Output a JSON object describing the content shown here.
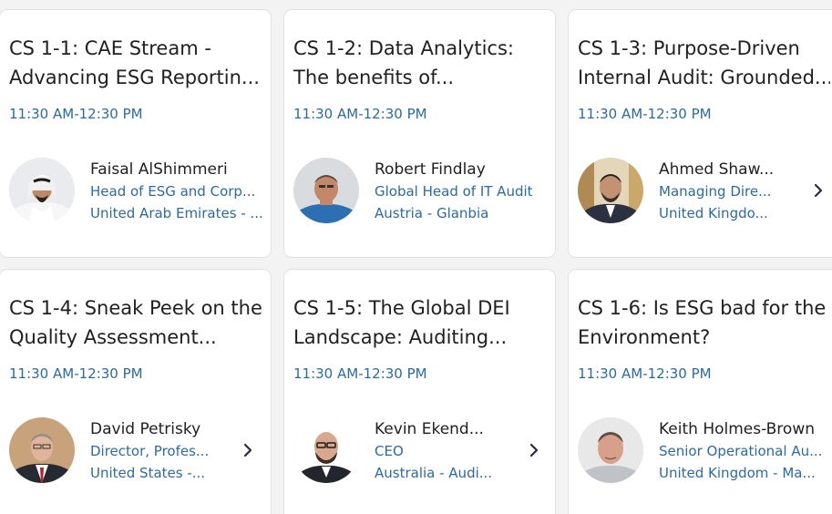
{
  "sessions": [
    {
      "title_line1": "CS 1-1: CAE Stream -",
      "title_line2": "Advancing ESG Reportin...",
      "time": "11:30 AM-12:30 PM",
      "speaker_name": "Faisal AlShimmeri",
      "speaker_role": "Head of ESG and Corp...",
      "speaker_location": "United Arab Emirates - ...",
      "has_chevron": false
    },
    {
      "title_line1": "CS 1-2: Data Analytics:",
      "title_line2": "The benefits of...",
      "time": "11:30 AM-12:30 PM",
      "speaker_name": "Robert Findlay",
      "speaker_role": "Global Head of IT Audit",
      "speaker_location": "Austria - Glanbia",
      "has_chevron": false
    },
    {
      "title_line1": "CS 1-3: Purpose-Driven",
      "title_line2": "Internal Audit: Grounded...",
      "time": "11:30 AM-12:30 PM",
      "speaker_name": "Ahmed Shaw...",
      "speaker_role": "Managing Dire...",
      "speaker_location": "United Kingdo...",
      "has_chevron": true
    },
    {
      "title_line1": "CS 1-4: Sneak Peek on the",
      "title_line2": "Quality Assessment...",
      "time": "11:30 AM-12:30 PM",
      "speaker_name": "David Petrisky",
      "speaker_role": "Director, Profes...",
      "speaker_location": "United States -...",
      "has_chevron": true
    },
    {
      "title_line1": "CS 1-5: The Global DEI",
      "title_line2": "Landscape: Auditing...",
      "time": "11:30 AM-12:30 PM",
      "speaker_name": "Kevin Ekend...",
      "speaker_role": "CEO",
      "speaker_location": "Australia - Audi...",
      "has_chevron": true
    },
    {
      "title_line1": "CS 1-6: Is ESG bad for the",
      "title_line2": "Environment?",
      "time": "11:30 AM-12:30 PM",
      "speaker_name": "Keith Holmes-Brown",
      "speaker_role": "Senior Operational Au...",
      "speaker_location": "United Kingdom - Ma...",
      "has_chevron": false
    }
  ],
  "colors": {
    "accent": "#2c6aa5",
    "text": "#202020",
    "card_bg": "#ffffff",
    "page_bg": "#f3f3f4"
  },
  "icons": {
    "chevron": "chevron-right-icon"
  }
}
